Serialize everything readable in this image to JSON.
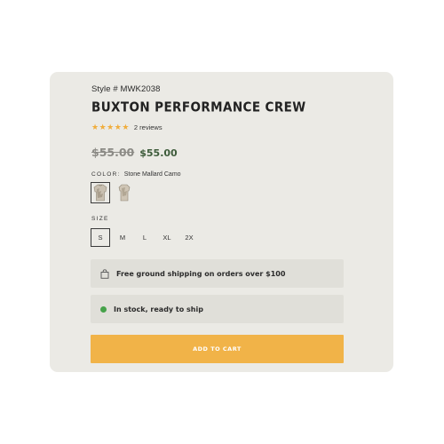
{
  "product": {
    "style_number": "Style # MWK2038",
    "title": "BUXTON PERFORMANCE CREW",
    "rating": {
      "stars": 5,
      "reviews_text": "2 reviews"
    },
    "price": {
      "original": "$55.00",
      "current": "$55.00"
    },
    "color": {
      "label": "COLOR:",
      "selected_name": "Stone Mallard Camo",
      "swatch_icons": [
        "shirt-front-icon",
        "shirt-back-icon"
      ],
      "selected_index": 0
    },
    "size": {
      "label": "SIZE",
      "options": [
        "S",
        "M",
        "L",
        "XL",
        "2X"
      ],
      "selected": "S"
    },
    "shipping_note": "Free ground shipping on orders over $100",
    "stock_note": "In stock, ready to ship",
    "add_to_cart_label": "ADD TO CART"
  },
  "colors": {
    "card_bg": "#ebeae5",
    "info_bg": "#e0dfd9",
    "star": "#f0ad3c",
    "sale_price": "#3e5c3b",
    "stock_dot": "#46a24a",
    "button": "#f1b348"
  }
}
